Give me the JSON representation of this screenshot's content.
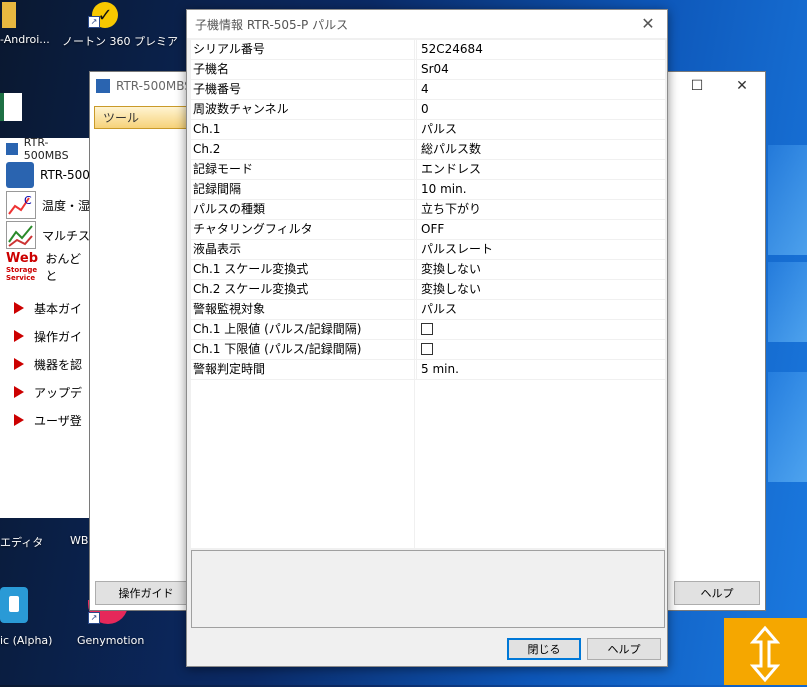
{
  "desktop": {
    "icons": [
      {
        "label": "-Androi..."
      },
      {
        "label": "ノートン 360 プレミア"
      },
      {
        "label": "エディタ"
      },
      {
        "label": "WB"
      },
      {
        "label": "ic (Alpha)"
      },
      {
        "label": "Genymotion"
      }
    ]
  },
  "launcher": {
    "title": "RTR-500MBS",
    "items": [
      {
        "label": "RTR-500"
      },
      {
        "label": "温度・湿"
      },
      {
        "label": "マルチス"
      },
      {
        "label": "おんどと"
      }
    ],
    "web_logo": {
      "line1": "Web",
      "line2": "Storage",
      "line3": "Service"
    },
    "links": [
      {
        "label": "基本ガイ"
      },
      {
        "label": "操作ガイ"
      },
      {
        "label": "機器を認"
      },
      {
        "label": "アップデ"
      },
      {
        "label": "ユーザ登"
      }
    ]
  },
  "mbs_window": {
    "title": "RTR-500MBS",
    "tool_tab": "ツール",
    "guide_button": "操作ガイド",
    "help_button": "ヘルプ"
  },
  "dialog": {
    "title": "子機情報 RTR-505-P パルス",
    "close_label": "閉じる",
    "help_label": "ヘルプ",
    "rows": [
      {
        "key": "シリアル番号",
        "value": "52C24684"
      },
      {
        "key": "子機名",
        "value": "Sr04"
      },
      {
        "key": "子機番号",
        "value": "4"
      },
      {
        "key": "周波数チャンネル",
        "value": "0"
      },
      {
        "key": "Ch.1",
        "value": "パルス"
      },
      {
        "key": "Ch.2",
        "value": "総パルス数"
      },
      {
        "key": "記録モード",
        "value": "エンドレス"
      },
      {
        "key": "記録間隔",
        "value": "10 min."
      },
      {
        "key": "パルスの種類",
        "value": "立ち下がり"
      },
      {
        "key": "チャタリングフィルタ",
        "value": "OFF"
      },
      {
        "key": "液晶表示",
        "value": "パルスレート"
      },
      {
        "key": "Ch.1 スケール変換式",
        "value": "変換しない"
      },
      {
        "key": "Ch.2 スケール変換式",
        "value": "変換しない"
      },
      {
        "key": "警報監視対象",
        "value": "パルス"
      },
      {
        "key": "Ch.1 上限値 (パルス/記録間隔)",
        "value": ""
      },
      {
        "key": "Ch.1 下限値 (パルス/記録間隔)",
        "value": ""
      },
      {
        "key": "警報判定時間",
        "value": "5 min."
      }
    ]
  }
}
